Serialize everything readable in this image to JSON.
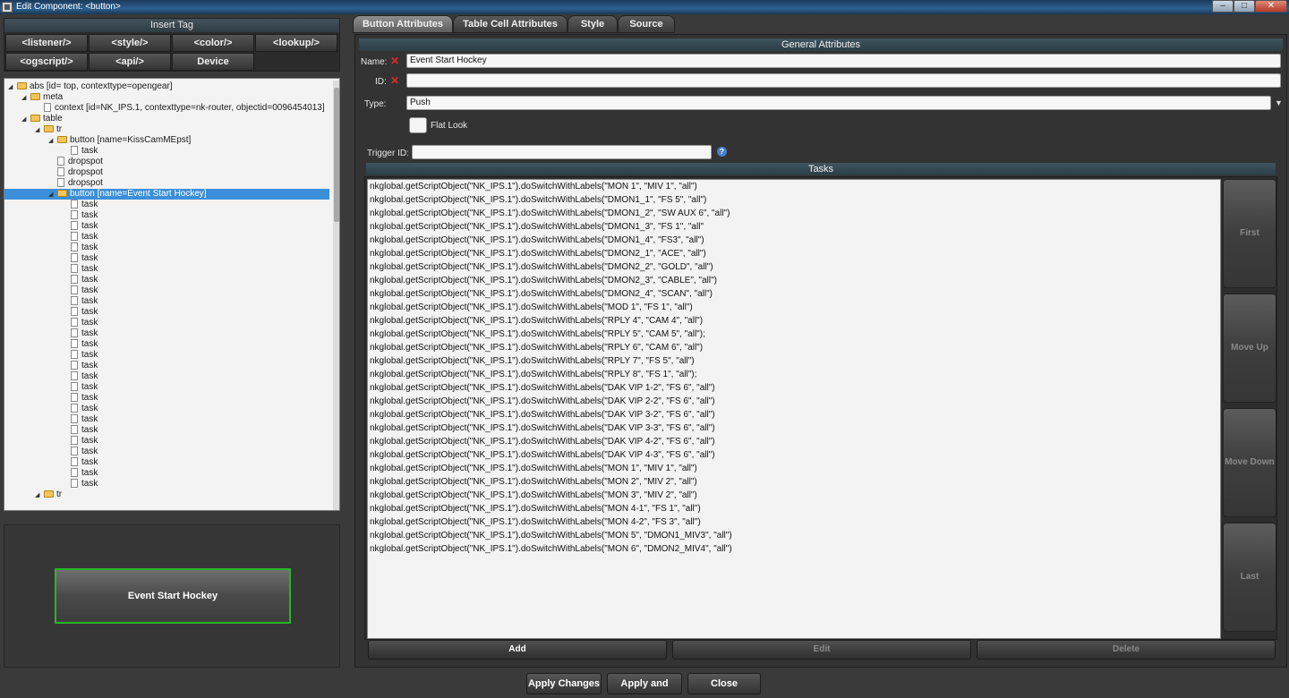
{
  "window": {
    "title": "Edit Component: <button>",
    "app_icon": "app-icon",
    "controls": {
      "minimize": "–",
      "maximize": "□",
      "close": "✕"
    }
  },
  "insert_tag": {
    "header": "Insert Tag",
    "buttons": [
      "<listener/>",
      "<style/>",
      "<color/>",
      "<lookup/>",
      "<ogscript/>",
      "<api/>",
      "Device"
    ]
  },
  "tree": {
    "nodes": [
      {
        "label": "abs [id=  top, contexttype=opengear]",
        "type": "folder",
        "arrow": "◢"
      },
      {
        "label": "meta",
        "type": "folder",
        "arrow": "◢"
      },
      {
        "label": "context [id=NK_IPS.1, contexttype=nk-router, objectid=0096454013]",
        "type": "file",
        "arrow": ""
      },
      {
        "label": "table",
        "type": "folder",
        "arrow": "◢"
      },
      {
        "label": "tr",
        "type": "folder",
        "arrow": "◢"
      },
      {
        "label": "button [name=KissCamMEpst]",
        "type": "folder",
        "arrow": "◢"
      },
      {
        "label": "task",
        "type": "file",
        "arrow": ""
      },
      {
        "label": "dropspot",
        "type": "file",
        "arrow": ""
      },
      {
        "label": "dropspot",
        "type": "file",
        "arrow": ""
      },
      {
        "label": "dropspot",
        "type": "file",
        "arrow": ""
      },
      {
        "label": "button [name=Event Start Hockey]",
        "type": "folder",
        "arrow": "◢",
        "selected": true
      },
      {
        "label": "task",
        "type": "file",
        "arrow": ""
      },
      {
        "label": "task",
        "type": "file",
        "arrow": ""
      },
      {
        "label": "task",
        "type": "file",
        "arrow": ""
      },
      {
        "label": "task",
        "type": "file",
        "arrow": ""
      },
      {
        "label": "task",
        "type": "file",
        "arrow": ""
      },
      {
        "label": "task",
        "type": "file",
        "arrow": ""
      },
      {
        "label": "task",
        "type": "file",
        "arrow": ""
      },
      {
        "label": "task",
        "type": "file",
        "arrow": ""
      },
      {
        "label": "task",
        "type": "file",
        "arrow": ""
      },
      {
        "label": "task",
        "type": "file",
        "arrow": ""
      },
      {
        "label": "task",
        "type": "file",
        "arrow": ""
      },
      {
        "label": "task",
        "type": "file",
        "arrow": ""
      },
      {
        "label": "task",
        "type": "file",
        "arrow": ""
      },
      {
        "label": "task",
        "type": "file",
        "arrow": ""
      },
      {
        "label": "task",
        "type": "file",
        "arrow": ""
      },
      {
        "label": "task",
        "type": "file",
        "arrow": ""
      },
      {
        "label": "task",
        "type": "file",
        "arrow": ""
      },
      {
        "label": "task",
        "type": "file",
        "arrow": ""
      },
      {
        "label": "task",
        "type": "file",
        "arrow": ""
      },
      {
        "label": "task",
        "type": "file",
        "arrow": ""
      },
      {
        "label": "task",
        "type": "file",
        "arrow": ""
      },
      {
        "label": "task",
        "type": "file",
        "arrow": ""
      },
      {
        "label": "task",
        "type": "file",
        "arrow": ""
      },
      {
        "label": "task",
        "type": "file",
        "arrow": ""
      },
      {
        "label": "task",
        "type": "file",
        "arrow": ""
      },
      {
        "label": "task",
        "type": "file",
        "arrow": ""
      },
      {
        "label": "task",
        "type": "file",
        "arrow": ""
      },
      {
        "label": "tr",
        "type": "folder",
        "arrow": "◢"
      }
    ]
  },
  "preview": {
    "button_label": "Event Start Hockey"
  },
  "tabs": [
    {
      "label": "Button Attributes",
      "active": true
    },
    {
      "label": "Table Cell Attributes",
      "active": false
    },
    {
      "label": "Style",
      "active": false
    },
    {
      "label": "Source",
      "active": false
    }
  ],
  "general": {
    "header": "General Attributes",
    "name_label": "Name:",
    "name_value": "Event Start Hockey",
    "id_label": "ID:",
    "id_value": "",
    "type_label": "Type:",
    "type_value": "Push",
    "flat_look_label": "Flat Look",
    "flat_look_checked": false,
    "error_mark": "✕"
  },
  "trigger": {
    "label": "Trigger ID:",
    "value": "",
    "help": "?"
  },
  "tasks": {
    "header": "Tasks",
    "items": [
      "nkglobal.getScriptObject(\"NK_IPS.1\").doSwitchWithLabels(\"MON 1\", \"MIV 1\", \"all\")",
      "nkglobal.getScriptObject(\"NK_IPS.1\").doSwitchWithLabels(\"DMON1_1\", \"FS 5\", \"all\")",
      "nkglobal.getScriptObject(\"NK_IPS.1\").doSwitchWithLabels(\"DMON1_2\", \"SW AUX 6\", \"all\")",
      "nkglobal.getScriptObject(\"NK_IPS.1\").doSwitchWithLabels(\"DMON1_3\", \"FS 1\", \"all\"",
      "nkglobal.getScriptObject(\"NK_IPS.1\").doSwitchWithLabels(\"DMON1_4\", \"FS3\", \"all\")",
      "nkglobal.getScriptObject(\"NK_IPS.1\").doSwitchWithLabels(\"DMON2_1\", \"ACE\", \"all\")",
      "nkglobal.getScriptObject(\"NK_IPS.1\").doSwitchWithLabels(\"DMON2_2\", \"GOLD\", \"all\")",
      "nkglobal.getScriptObject(\"NK_IPS.1\").doSwitchWithLabels(\"DMON2_3\", \"CABLE\", \"all\")",
      "nkglobal.getScriptObject(\"NK_IPS.1\").doSwitchWithLabels(\"DMON2_4\", \"SCAN\", \"all\")",
      "nkglobal.getScriptObject(\"NK_IPS.1\").doSwitchWithLabels(\"MOD 1\", \"FS 1\", \"all\")",
      "nkglobal.getScriptObject(\"NK_IPS.1\").doSwitchWithLabels(\"RPLY 4\", \"CAM 4\", \"all\")",
      "nkglobal.getScriptObject(\"NK_IPS.1\").doSwitchWithLabels(\"RPLY 5\", \"CAM 5\", \"all\");",
      "nkglobal.getScriptObject(\"NK_IPS.1\").doSwitchWithLabels(\"RPLY 6\", \"CAM 6\", \"all\")",
      "nkglobal.getScriptObject(\"NK_IPS.1\").doSwitchWithLabels(\"RPLY 7\", \"FS 5\", \"all\")",
      "nkglobal.getScriptObject(\"NK_IPS.1\").doSwitchWithLabels(\"RPLY 8\", \"FS 1\", \"all\");",
      "nkglobal.getScriptObject(\"NK_IPS.1\").doSwitchWithLabels(\"DAK VIP 1-2\", \"FS 6\", \"all\")",
      "nkglobal.getScriptObject(\"NK_IPS.1\").doSwitchWithLabels(\"DAK VIP 2-2\", \"FS 6\", \"all\")",
      "nkglobal.getScriptObject(\"NK_IPS.1\").doSwitchWithLabels(\"DAK VIP 3-2\", \"FS 6\", \"all\")",
      "nkglobal.getScriptObject(\"NK_IPS.1\").doSwitchWithLabels(\"DAK VIP 3-3\", \"FS 6\", \"all\")",
      "nkglobal.getScriptObject(\"NK_IPS.1\").doSwitchWithLabels(\"DAK VIP 4-2\", \"FS 6\", \"all\")",
      "nkglobal.getScriptObject(\"NK_IPS.1\").doSwitchWithLabels(\"DAK VIP 4-3\", \"FS 6\", \"all\")",
      "nkglobal.getScriptObject(\"NK_IPS.1\").doSwitchWithLabels(\"MON 1\", \"MIV 1\", \"all\")",
      "nkglobal.getScriptObject(\"NK_IPS.1\").doSwitchWithLabels(\"MON 2\", \"MIV 2\", \"all\")",
      "nkglobal.getScriptObject(\"NK_IPS.1\").doSwitchWithLabels(\"MON 3\", \"MIV 2\", \"all\")",
      "nkglobal.getScriptObject(\"NK_IPS.1\").doSwitchWithLabels(\"MON 4-1\", \"FS 1\", \"all\")",
      "nkglobal.getScriptObject(\"NK_IPS.1\").doSwitchWithLabels(\"MON 4-2\", \"FS 3\", \"all\")",
      "nkglobal.getScriptObject(\"NK_IPS.1\").doSwitchWithLabels(\"MON 5\", \"DMON1_MIV3\", \"all\")",
      "nkglobal.getScriptObject(\"NK_IPS.1\").doSwitchWithLabels(\"MON 6\", \"DMON2_MIV4\", \"all\")"
    ],
    "side_buttons": [
      "First",
      "Move Up",
      "Move Down",
      "Last"
    ],
    "bottom_buttons": [
      {
        "label": "Add",
        "enabled": true
      },
      {
        "label": "Edit",
        "enabled": false
      },
      {
        "label": "Delete",
        "enabled": false
      }
    ]
  },
  "footer": {
    "buttons": [
      "Apply Changes",
      "Apply and Close",
      "Close"
    ]
  },
  "colors": {
    "selection": "#3b8fd8",
    "preview_border": "#28b428",
    "error": "#e02b2b",
    "header_bar": "#3f5560"
  }
}
